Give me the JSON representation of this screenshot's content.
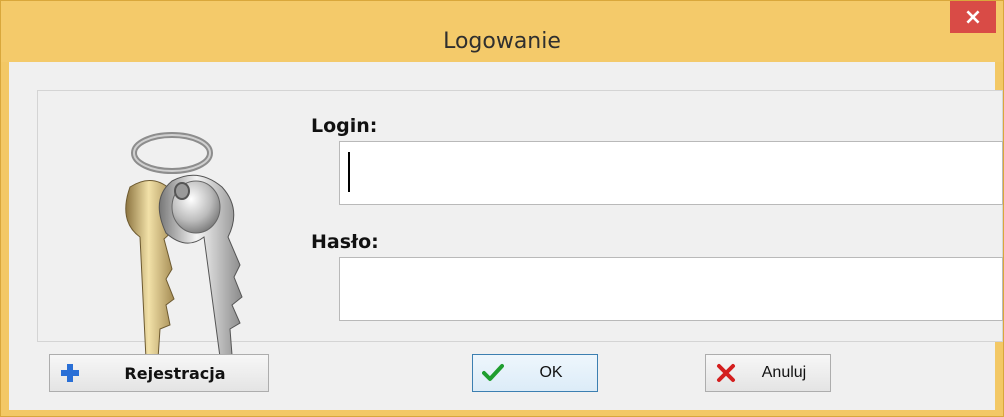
{
  "window": {
    "title": "Logowanie",
    "close_label": "×"
  },
  "form": {
    "login_label": "Login:",
    "login_value": "",
    "password_label": "Hasło:",
    "password_value": ""
  },
  "buttons": {
    "register_label": "Rejestracja",
    "ok_label": "OK",
    "cancel_label": "Anuluj"
  },
  "icons": {
    "register": "plus-icon",
    "ok": "checkmark-icon",
    "cancel": "x-icon",
    "hero": "keys-icon"
  },
  "colors": {
    "titlebar": "#f4ca6a",
    "close": "#d94b46",
    "ok_focus_border": "#3c7fb1"
  }
}
